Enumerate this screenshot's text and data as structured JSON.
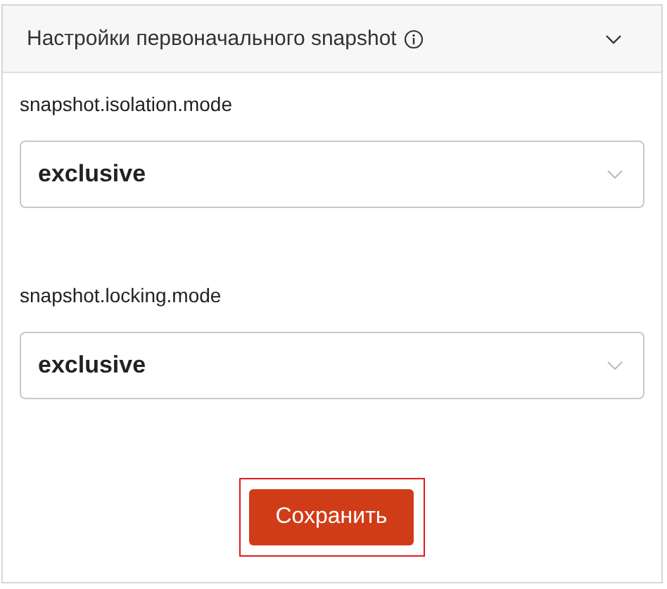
{
  "section": {
    "title": "Настройки первоначального snapshot",
    "expanded": true
  },
  "fields": [
    {
      "label": "snapshot.isolation.mode",
      "value": "exclusive"
    },
    {
      "label": "snapshot.locking.mode",
      "value": "exclusive"
    }
  ],
  "save_button": {
    "label": "Сохранить",
    "highlighted": true
  }
}
